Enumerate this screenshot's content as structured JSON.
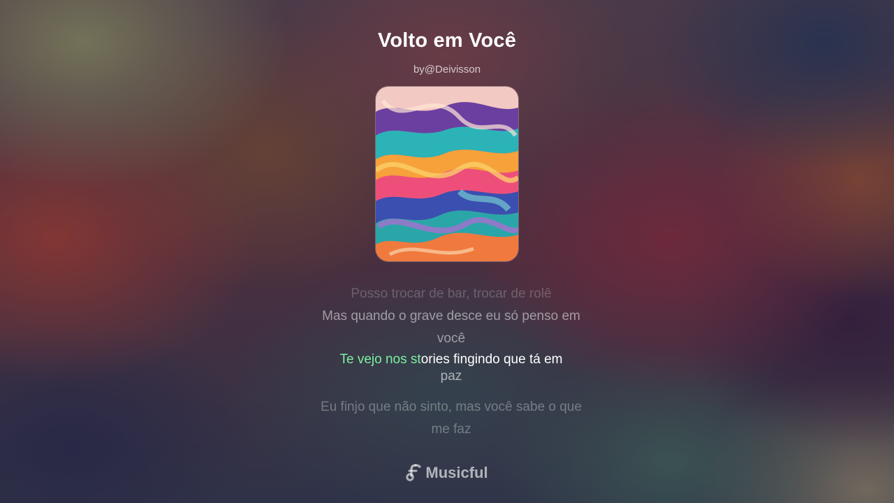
{
  "song": {
    "title": "Volto em Você",
    "author": "by@Deivisson"
  },
  "cover": {
    "icon": "abstract-swirl-artwork"
  },
  "lyrics": {
    "past_2": "Posso trocar de bar, trocar de rolê",
    "past_1": "Mas quando o grave desce eu só penso em você",
    "current_sung": "Te vejo nos st",
    "current_unsung": "ories fingindo que tá em",
    "current_tail": "paz",
    "next_1": "Eu finjo que não sinto, mas você sabe o que me faz"
  },
  "colors": {
    "highlight": "#7ef0a0"
  },
  "brand": {
    "name": "Musicful",
    "icon": "music-note-icon"
  }
}
